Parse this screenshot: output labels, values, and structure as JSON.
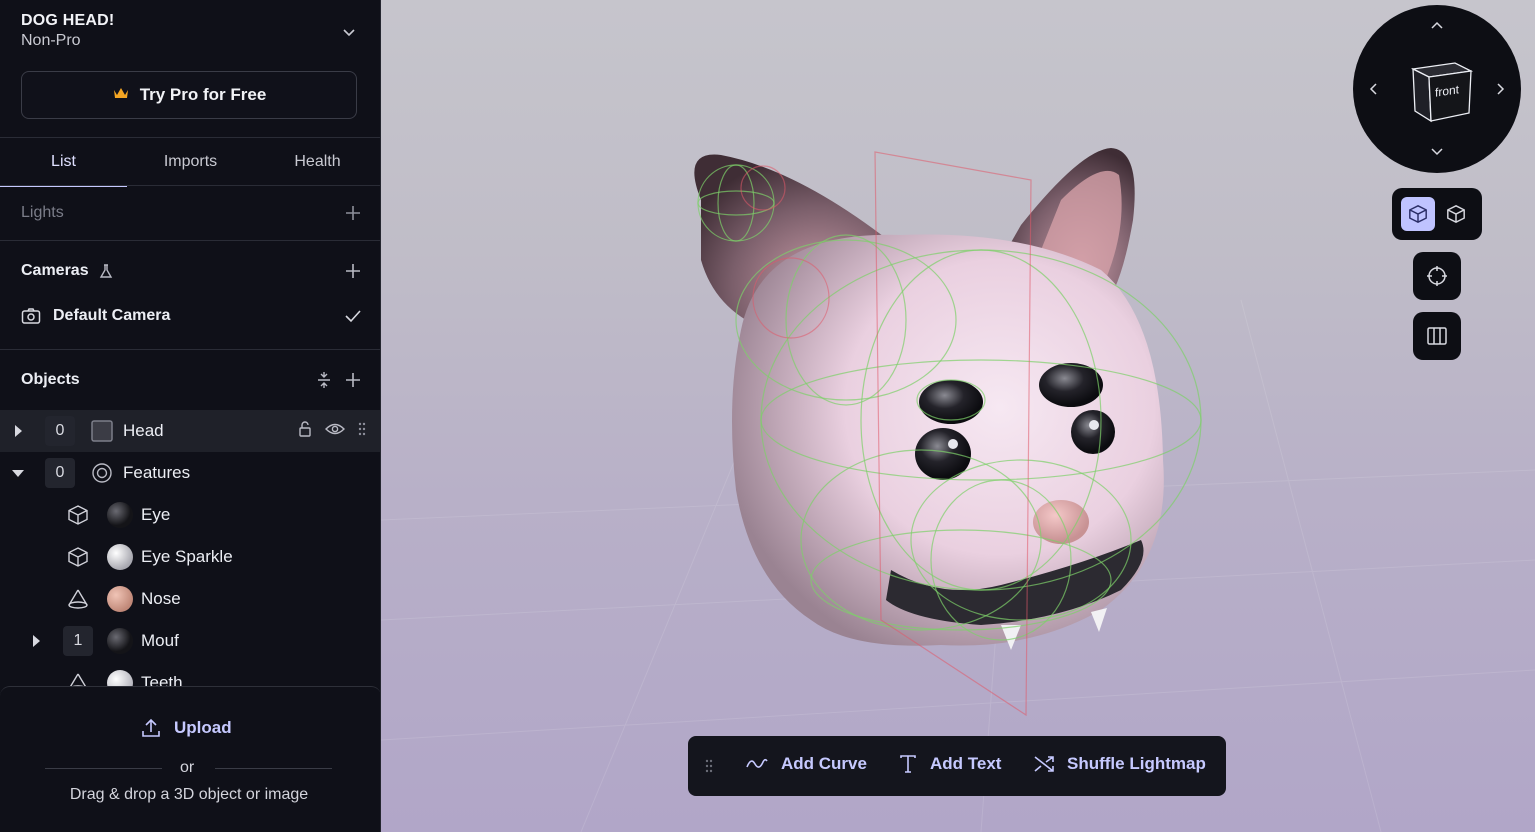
{
  "project": {
    "title": "DOG HEAD!",
    "plan": "Non-Pro",
    "try_pro_label": "Try Pro for Free"
  },
  "tabs": [
    {
      "label": "List",
      "active": true
    },
    {
      "label": "Imports",
      "active": false
    },
    {
      "label": "Health",
      "active": false
    }
  ],
  "lights": {
    "label": "Lights"
  },
  "cameras": {
    "label": "Cameras",
    "items": [
      {
        "name": "Default Camera",
        "selected": true
      }
    ]
  },
  "objects": {
    "label": "Objects",
    "items": [
      {
        "count": "0",
        "name": "Head",
        "icon": "square-icon",
        "expanded": false,
        "selected": true
      },
      {
        "count": "0",
        "name": "Features",
        "icon": "group-icon",
        "expanded": true,
        "selected": false
      },
      {
        "name": "Eye",
        "icon": "cube-icon",
        "material_color": "#222228"
      },
      {
        "name": "Eye Sparkle",
        "icon": "cube-icon",
        "material_color": "#d9d9df"
      },
      {
        "name": "Nose",
        "icon": "cone-icon",
        "material_color": "#d6a494"
      },
      {
        "count": "1",
        "name": "Mouf",
        "icon": "sphere-icon",
        "expanded": false,
        "material_color": "#2a2a30"
      },
      {
        "name": "Teeth",
        "icon": "cone-icon",
        "material_color": "#e6e6ea"
      }
    ]
  },
  "upload": {
    "button_label": "Upload",
    "or_label": "or",
    "hint": "Drag & drop a 3D object or image"
  },
  "viewport": {
    "nav_cube_face": "front",
    "toolbar": [
      {
        "label": "Add Curve",
        "icon": "curve-icon"
      },
      {
        "label": "Add Text",
        "icon": "text-icon"
      },
      {
        "label": "Shuffle Lightmap",
        "icon": "shuffle-icon"
      }
    ]
  },
  "colors": {
    "accent": "#c6c9ff",
    "sidebar_bg": "#0f1018",
    "crown": "#f5a623"
  }
}
